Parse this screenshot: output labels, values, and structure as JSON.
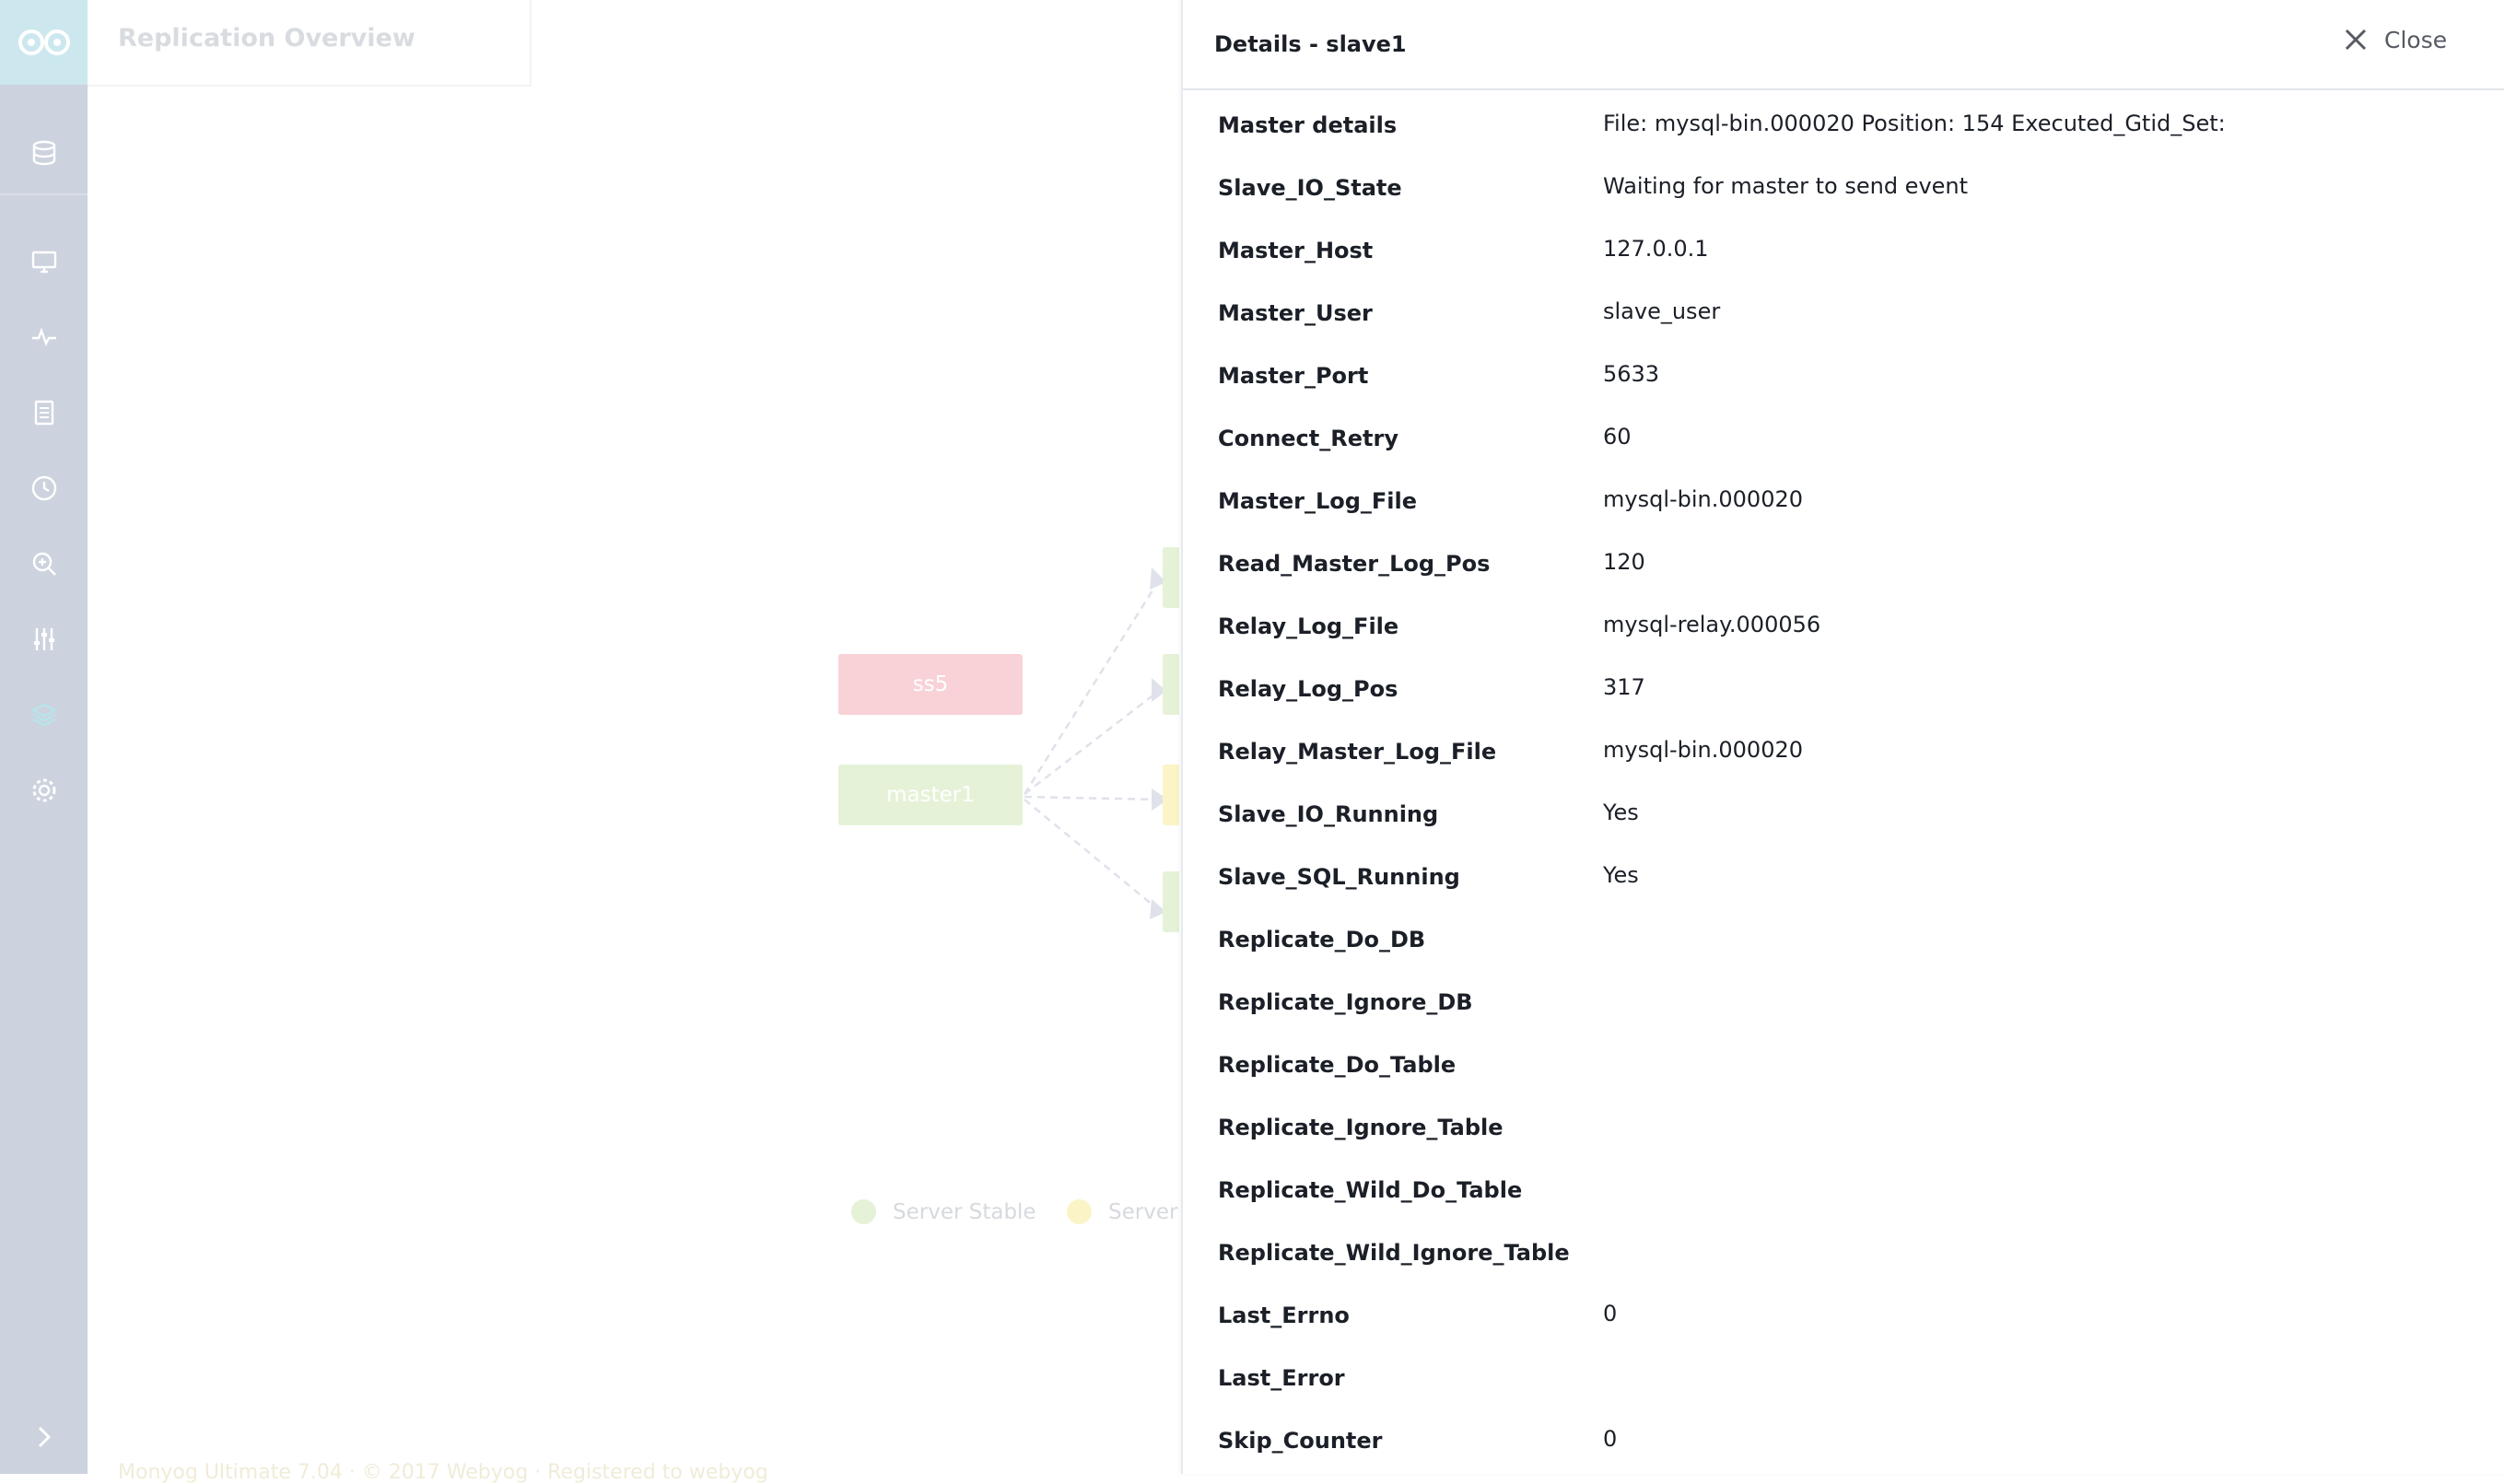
{
  "app": {
    "page_title": "Replication Overview",
    "footer": "Monyog Ultimate 7.04 · © 2017 Webyog · Registered to webyog"
  },
  "sidebar": {
    "icons": [
      "logo-icon",
      "database-icon",
      "monitor-icon",
      "activity-icon",
      "document-icon",
      "clock-icon",
      "zoom-icon",
      "sliders-icon",
      "layers-icon",
      "gear-icon",
      "chevron-right-icon"
    ]
  },
  "topology": {
    "nodes": [
      {
        "label": "ss5",
        "status": "error"
      },
      {
        "label": "master1",
        "status": "stable"
      }
    ],
    "legend": [
      {
        "label": "Server Stable",
        "color": "#e5f2d7"
      },
      {
        "label": "Server",
        "color": "#fbf4c6"
      }
    ]
  },
  "panel": {
    "title": "Details - slave1",
    "close_label": "Close",
    "rows": [
      {
        "label": "Master details",
        "value": "File: mysql-bin.000020 Position: 154 Executed_Gtid_Set:"
      },
      {
        "label": "Slave_IO_State",
        "value": "Waiting for master to send event"
      },
      {
        "label": "Master_Host",
        "value": "127.0.0.1"
      },
      {
        "label": "Master_User",
        "value": "slave_user"
      },
      {
        "label": "Master_Port",
        "value": "5633"
      },
      {
        "label": "Connect_Retry",
        "value": "60"
      },
      {
        "label": "Master_Log_File",
        "value": "mysql-bin.000020"
      },
      {
        "label": "Read_Master_Log_Pos",
        "value": "120"
      },
      {
        "label": "Relay_Log_File",
        "value": "mysql-relay.000056"
      },
      {
        "label": "Relay_Log_Pos",
        "value": "317"
      },
      {
        "label": "Relay_Master_Log_File",
        "value": "mysql-bin.000020"
      },
      {
        "label": "Slave_IO_Running",
        "value": "Yes"
      },
      {
        "label": "Slave_SQL_Running",
        "value": "Yes"
      },
      {
        "label": "Replicate_Do_DB",
        "value": ""
      },
      {
        "label": "Replicate_Ignore_DB",
        "value": ""
      },
      {
        "label": "Replicate_Do_Table",
        "value": ""
      },
      {
        "label": "Replicate_Ignore_Table",
        "value": ""
      },
      {
        "label": "Replicate_Wild_Do_Table",
        "value": ""
      },
      {
        "label": "Replicate_Wild_Ignore_Table",
        "value": ""
      },
      {
        "label": "Last_Errno",
        "value": "0"
      },
      {
        "label": "Last_Error",
        "value": ""
      },
      {
        "label": "Skip_Counter",
        "value": "0"
      }
    ]
  }
}
